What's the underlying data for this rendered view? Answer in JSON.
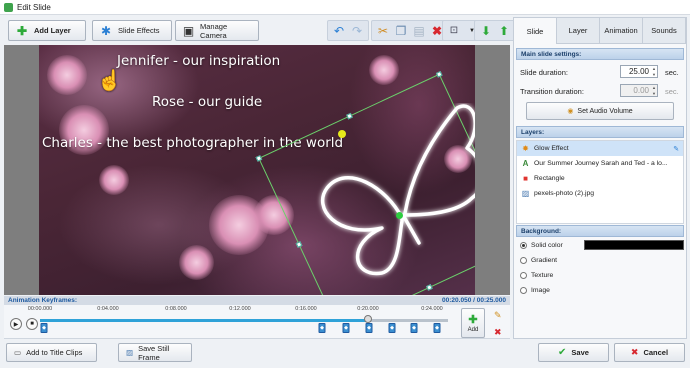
{
  "window": {
    "title": "Edit Slide"
  },
  "toolbar": {
    "add_layer": "Add Layer",
    "slide_effects": "Slide Effects",
    "manage_camera": "Manage Camera"
  },
  "preview": {
    "captions": [
      "Jennifer - our inspiration",
      "Rose - our guide",
      "Charles - the best photographer in the world"
    ]
  },
  "keyframes": {
    "header": "Animation Keyframes:",
    "time": "00:20.050 / 00:25.000",
    "ticks": [
      "00:00.000",
      "0:04.000",
      "0:08.000",
      "0:12.000",
      "0:16.000",
      "0:20.000",
      "0:24.000"
    ],
    "add_label": "Add"
  },
  "bottom": {
    "add_title_clips": "Add to Title Clips",
    "save_still": "Save Still Frame",
    "save": "Save",
    "cancel": "Cancel"
  },
  "panel": {
    "tabs": [
      "Slide",
      "Layer",
      "Animation",
      "Sounds"
    ],
    "main_settings": "Main slide settings:",
    "slide_duration_label": "Slide duration:",
    "slide_duration": "25.00",
    "transition_label": "Transition duration:",
    "transition_duration": "0.00",
    "sec": "sec.",
    "audio_volume": "Set Audio Volume",
    "layers_head": "Layers:",
    "layers": [
      "Glow Effect",
      "Our Summer Journey    Sarah and Ted - a lo...",
      "Rectangle",
      "pexels-photo (2).jpg"
    ],
    "background_head": "Background:",
    "bg_options": [
      "Solid color",
      "Gradient",
      "Texture",
      "Image"
    ],
    "bg_color": "#000000"
  }
}
